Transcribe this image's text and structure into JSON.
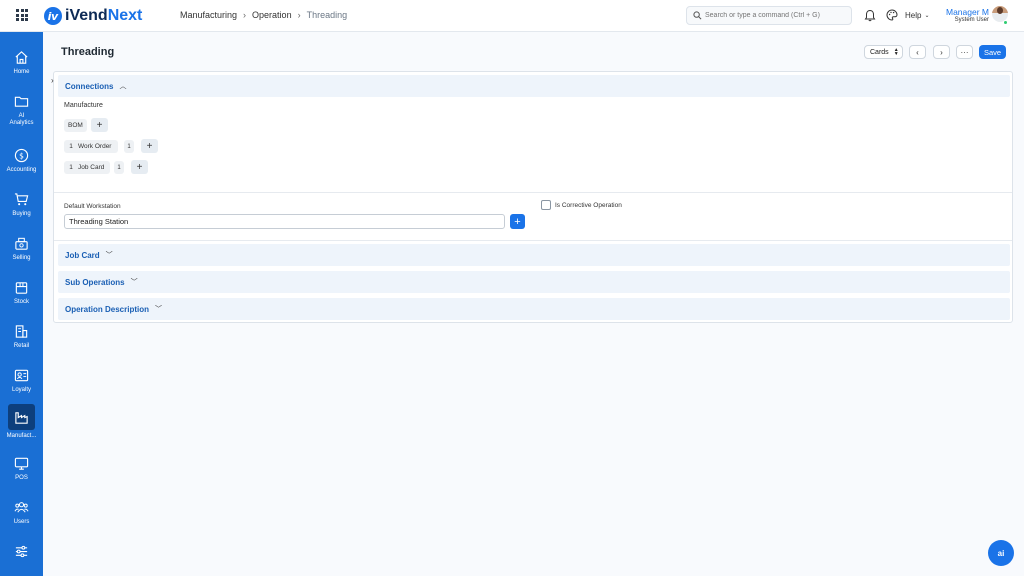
{
  "app": {
    "logo_prefix": "iVend",
    "logo_suffix": "Next",
    "logo_mark": "iN"
  },
  "breadcrumb": [
    "Manufacturing",
    "Operation",
    "Threading"
  ],
  "search": {
    "placeholder": "Search or type a command (Ctrl + G)"
  },
  "header": {
    "help_label": "Help",
    "user_name": "Manager M",
    "user_role": "System User"
  },
  "sidebar": {
    "items": [
      {
        "label": "Home",
        "icon": "home-icon"
      },
      {
        "label": "AI\nAnalytics",
        "icon": "folder-icon"
      },
      {
        "label": "Accounting",
        "icon": "dollar-icon"
      },
      {
        "label": "Buying",
        "icon": "cart-icon"
      },
      {
        "label": "Selling",
        "icon": "register-icon"
      },
      {
        "label": "Stock",
        "icon": "box-icon"
      },
      {
        "label": "Retail",
        "icon": "store-icon"
      },
      {
        "label": "Loyalty",
        "icon": "id-card-icon"
      },
      {
        "label": "Manufact...",
        "icon": "factory-icon"
      },
      {
        "label": "POS",
        "icon": "monitor-icon"
      },
      {
        "label": "Users",
        "icon": "users-icon"
      },
      {
        "label": "",
        "icon": "sliders-icon"
      }
    ]
  },
  "page": {
    "title": "Threading",
    "view_selector": "Cards",
    "more_label": "···",
    "save_label": "Save"
  },
  "connections": {
    "title": "Connections",
    "group_label": "Manufacture",
    "bom_label": "BOM",
    "work_order": {
      "count": "1",
      "label": "Work Order",
      "extra": "1"
    },
    "job_card": {
      "count": "1",
      "label": "Job Card",
      "extra": "1"
    }
  },
  "form": {
    "workstation_label": "Default Workstation",
    "workstation_value": "Threading Station",
    "corrective_label": "Is Corrective Operation"
  },
  "sections": {
    "job_card": "Job Card",
    "sub_operations": "Sub Operations",
    "operation_description": "Operation Description"
  },
  "assistant": {
    "label": "ai"
  },
  "colors": {
    "primary": "#1a73e8",
    "sidebar": "#1a6fd4",
    "sidebar_active": "#0d3f7d"
  }
}
